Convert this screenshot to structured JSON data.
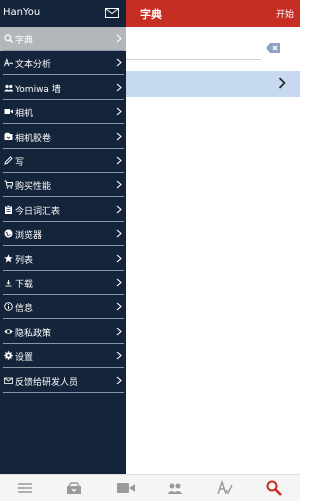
{
  "drawer": {
    "app_name": "HanYou",
    "items": [
      {
        "label": "字典",
        "icon": "search-icon",
        "active": true
      },
      {
        "label": "文本分析",
        "icon": "text-analysis-icon"
      },
      {
        "label": "Yomiwa 墙",
        "icon": "people-icon"
      },
      {
        "label": "相机",
        "icon": "video-camera-icon"
      },
      {
        "label": "相机胶卷",
        "icon": "camera-roll-icon"
      },
      {
        "label": "写",
        "icon": "pencil-icon"
      },
      {
        "label": "购买性能",
        "icon": "cart-icon"
      },
      {
        "label": "今日词汇表",
        "icon": "clipboard-icon"
      },
      {
        "label": "浏览器",
        "icon": "globe-icon"
      },
      {
        "label": "列表",
        "icon": "star-icon"
      },
      {
        "label": "下载",
        "icon": "download-icon"
      },
      {
        "label": "信息",
        "icon": "info-icon"
      },
      {
        "label": "隐私政策",
        "icon": "eye-icon"
      },
      {
        "label": "设置",
        "icon": "gear-icon"
      },
      {
        "label": "反馈给研发人员",
        "icon": "mail-icon"
      }
    ]
  },
  "main": {
    "title": "字典",
    "start_label": "开始"
  },
  "tabs": [
    "menu-icon",
    "inbox-icon",
    "video-camera-icon",
    "people-icon",
    "handwriting-icon",
    "search-icon"
  ],
  "colors": {
    "header": "#c62d23",
    "drawer": "#14243a",
    "active_item": "#b3b6bb",
    "result_row": "#c6d9f1",
    "active_tab": "#c62d23"
  }
}
